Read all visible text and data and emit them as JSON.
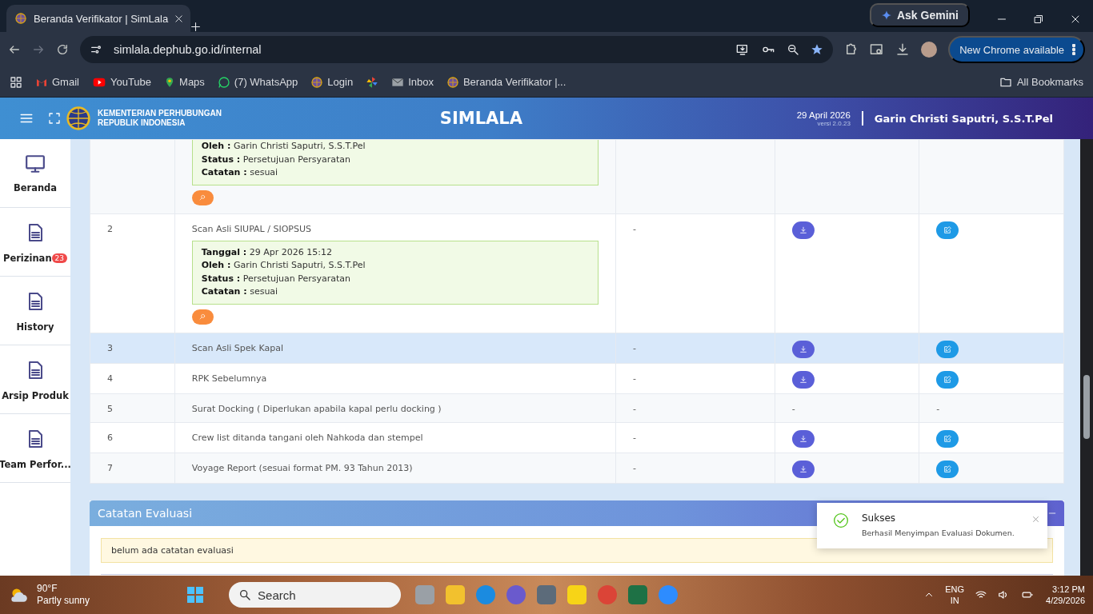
{
  "browser": {
    "tab_title": "Beranda Verifikator | SimLala",
    "ask_button": "Ask Gemini",
    "url": "simlala.dephub.go.id/internal",
    "update_button": "New Chrome available",
    "bookmarks": [
      {
        "label": "Gmail",
        "kind": "mail"
      },
      {
        "label": "YouTube",
        "kind": "video"
      },
      {
        "label": "Maps",
        "kind": "map"
      },
      {
        "label": "(7) WhatsApp",
        "kind": "chat"
      },
      {
        "label": "Login",
        "kind": "site"
      },
      {
        "kind": "photos"
      },
      {
        "label": "Inbox",
        "kind": "inbox"
      },
      {
        "label": "Beranda Verifikator |...",
        "kind": "site"
      }
    ],
    "all_bookmarks": "All Bookmarks"
  },
  "header": {
    "org_line_1": "KEMENTERIAN PERHUBUNGAN",
    "org_line_2": "REPUBLIK INDONESIA",
    "app_title": "SIMLALA",
    "date": "29 April 2026",
    "version": "versi 2.0.23",
    "user": "Garin Christi Saputri, S.S.T.Pel"
  },
  "sidebar": {
    "items": [
      {
        "label": "Beranda",
        "kind": "home"
      },
      {
        "label": "Perizinan",
        "kind": "page",
        "badge": "23"
      },
      {
        "label": "History",
        "kind": "page"
      },
      {
        "label": "Arsip Produk",
        "kind": "page"
      },
      {
        "label": "Team Perfor...",
        "kind": "page"
      }
    ]
  },
  "table": {
    "rows": [
      {
        "highlighted": false,
        "log": [
          {
            "label": "Oleh :",
            "value": "Garin Christi Saputri, S.S.T.Pel"
          },
          {
            "label": "Status :",
            "value": "Persetujuan Persyaratan"
          },
          {
            "label": "Catatan :",
            "value": "sesuai"
          }
        ],
        "download": {
          "kind": "none"
        },
        "edit": {
          "kind": "none"
        }
      },
      {
        "number": "2",
        "document": "Scan Asli SIUPAL / SIOPSUS",
        "highlighted": false,
        "log": [
          {
            "label": "Tanggal :",
            "value": "29 Apr 2026 15:12"
          },
          {
            "label": "Oleh :",
            "value": "Garin Christi Saputri, S.S.T.Pel"
          },
          {
            "label": "Status :",
            "value": "Persetujuan Persyaratan"
          },
          {
            "label": "Catatan :",
            "value": "sesuai"
          }
        ],
        "column_3": "-",
        "download": {
          "kind": "button"
        },
        "edit": {
          "kind": "button"
        }
      },
      {
        "number": "3",
        "document": "Scan Asli Spek Kapal",
        "highlighted": true,
        "column_3": "-",
        "download": {
          "kind": "button"
        },
        "edit": {
          "kind": "button"
        }
      },
      {
        "number": "4",
        "document": "RPK Sebelumnya",
        "highlighted": false,
        "column_3": "-",
        "download": {
          "kind": "button"
        },
        "edit": {
          "kind": "button"
        }
      },
      {
        "number": "5",
        "document": "Surat Docking ( Diperlukan apabila kapal perlu docking )",
        "highlighted": false,
        "column_3": "-",
        "download": {
          "kind": "text",
          "text": "-"
        },
        "edit": {
          "kind": "text",
          "text": "-"
        }
      },
      {
        "number": "6",
        "document": "Crew list ditanda tangani oleh Nahkoda dan stempel",
        "highlighted": false,
        "column_3": "-",
        "download": {
          "kind": "button"
        },
        "edit": {
          "kind": "button"
        }
      },
      {
        "number": "7",
        "document": "Voyage Report (sesuai format PM. 93 Tahun 2013)",
        "highlighted": false,
        "column_3": "-",
        "download": {
          "kind": "button"
        },
        "edit": {
          "kind": "button"
        }
      }
    ]
  },
  "evaluation": {
    "title": "Catatan Evaluasi",
    "note": "belum ada catatan evaluasi"
  },
  "toast": {
    "title": "Sukses",
    "message": "Berhasil Menyimpan Evaluasi Dokumen."
  },
  "taskbar": {
    "temperature": "90°F",
    "weather": "Partly sunny",
    "search_placeholder": "Search",
    "language": "ENG",
    "region": "IN",
    "time": "3:12 PM",
    "date": "4/29/2026"
  }
}
